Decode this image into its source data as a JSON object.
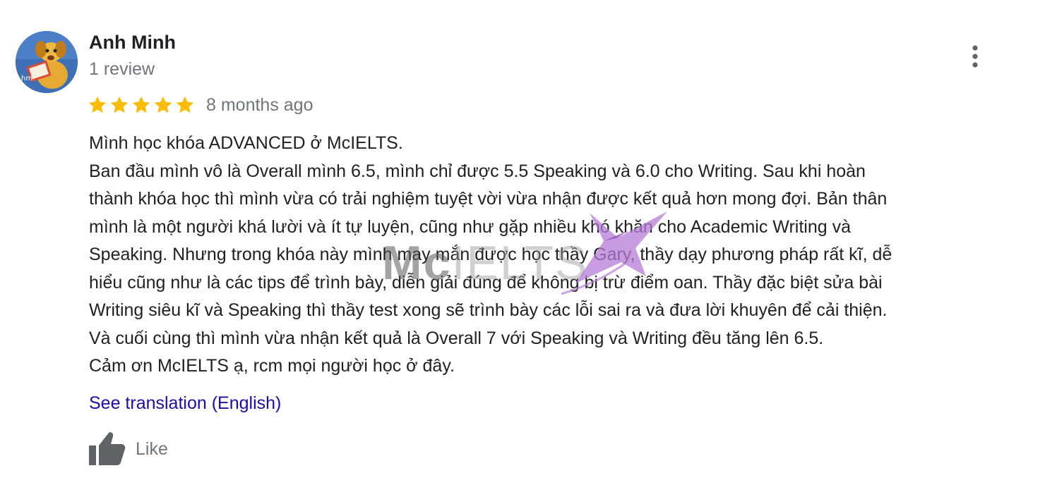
{
  "reviewer": {
    "name": "Anh Minh",
    "review_count": "1 review",
    "avatar_icon": "dog-reading-book-avatar"
  },
  "rating": {
    "stars": 5,
    "max": 5,
    "color": "#fbbc04"
  },
  "timestamp": "8 months ago",
  "review": {
    "lines": [
      "Mình học khóa ADVANCED ở McIELTS.",
      "Ban đầu mình vô là Overall mình 6.5, mình chỉ được 5.5 Speaking và 6.0 cho Writing. Sau khi hoàn",
      "thành khóa học thì mình vừa có trải nghiệm tuyệt vời vừa nhận được kết quả hơn mong đợi. Bản thân",
      "mình là một người khá lười và ít tự luyện, cũng như gặp nhiều khó khăn cho Academic Writing và",
      "Speaking. Nhưng trong khóa này mình may mắn được học thầy Gary, thầy dạy phương pháp rất kĩ, dễ",
      "hiểu cũng như là các tips để trình bày, diễn giải đúng để không bị trừ điểm oan. Thầy đặc biệt sửa bài",
      "Writing siêu kĩ và Speaking thì thầy test xong sẽ trình bày các lỗi sai ra và đưa lời khuyên để cải thiện.",
      "Và cuối cùng thì mình vừa nhận kết quả là Overall 7 với Speaking và Writing đều tăng lên 6.5.",
      "Cảm ơn McIELTS ạ, rcm mọi người học ở đây."
    ]
  },
  "actions": {
    "translate_label": "See translation (English)",
    "like_label": "Like",
    "more_icon": "more-vert-icon",
    "like_icon": "thumbs-up-icon"
  },
  "watermark": {
    "brand_bold": "Mc",
    "brand_light": "IELTS",
    "accent_color": "#b57bd6"
  },
  "colors": {
    "link": "#1a0dab",
    "muted": "#70757a",
    "text": "#202124"
  }
}
